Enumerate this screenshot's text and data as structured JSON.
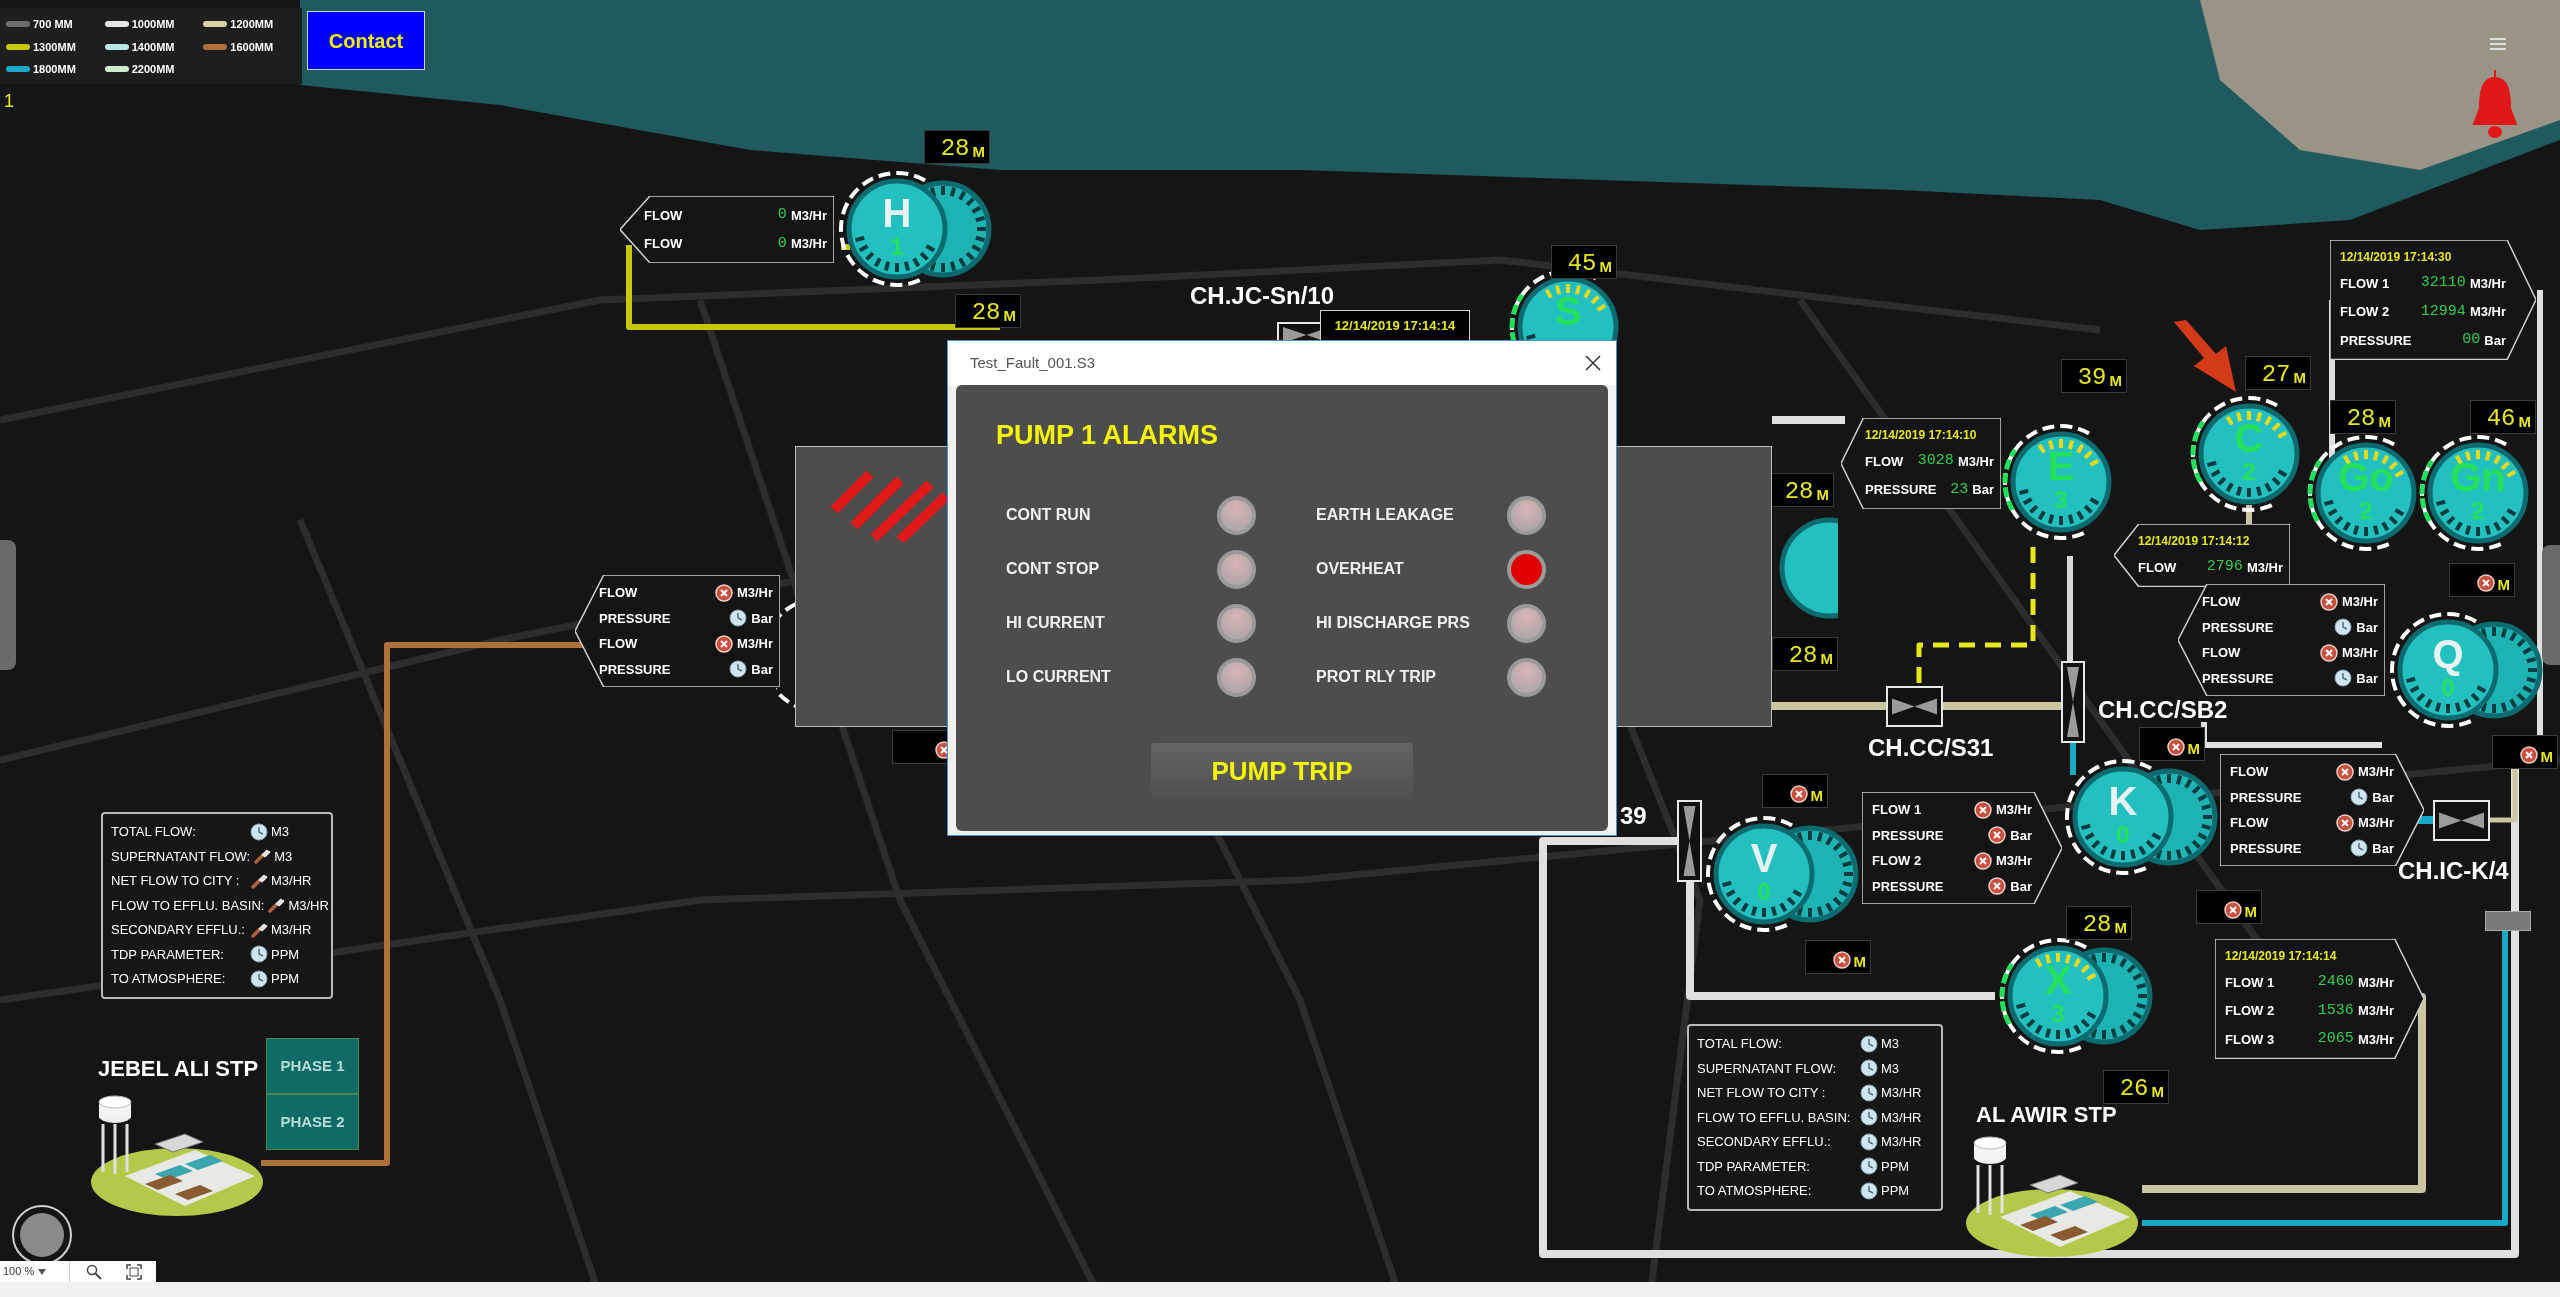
{
  "legend": [
    {
      "label": "700 MM",
      "color": "#6e6e6e"
    },
    {
      "label": "1000MM",
      "color": "#e6e6e6"
    },
    {
      "label": "1200MM",
      "color": "#d6d2a6"
    },
    {
      "label": "1300MM",
      "color": "#c8c800"
    },
    {
      "label": "1400MM",
      "color": "#b6e6e6"
    },
    {
      "label": "1600MM",
      "color": "#b0703c"
    },
    {
      "label": "1800MM",
      "color": "#18a8c8"
    },
    {
      "label": "2200MM",
      "color": "#cceccc"
    }
  ],
  "contact_button": "Contact",
  "page_indicator": "1",
  "pumps": [
    {
      "letter": "H",
      "number": "1",
      "running": false
    },
    {
      "letter": "S",
      "running": true
    },
    {
      "letter": "E",
      "number": "3",
      "running": true
    },
    {
      "letter": "C",
      "number": "2",
      "running": true
    },
    {
      "letter": "Go",
      "number": "2",
      "running": true
    },
    {
      "letter": "Gn",
      "number": "2",
      "running": true
    },
    {
      "letter": "Q",
      "number": "0",
      "running": false
    },
    {
      "letter": "K",
      "number": "0",
      "running": false
    },
    {
      "letter": "V",
      "number": "0",
      "running": false
    },
    {
      "letter": "X",
      "number": "3",
      "running": true
    }
  ],
  "displays": [
    {
      "kind": "value",
      "value": "28",
      "unit": "M"
    },
    {
      "kind": "value",
      "value": "28",
      "unit": "M"
    },
    {
      "kind": "value",
      "value": "45",
      "unit": "M"
    },
    {
      "kind": "value",
      "value": "28",
      "unit": "M"
    },
    {
      "kind": "value",
      "value": "28",
      "unit": "M"
    },
    {
      "kind": "value",
      "value": "39",
      "unit": "M"
    },
    {
      "kind": "value",
      "value": "27",
      "unit": "M"
    },
    {
      "kind": "value",
      "value": "28",
      "unit": "M"
    },
    {
      "kind": "value",
      "value": "46",
      "unit": "M"
    },
    {
      "kind": "error",
      "unit": "M"
    },
    {
      "kind": "error",
      "unit": "M"
    },
    {
      "kind": "error",
      "unit": "M"
    },
    {
      "kind": "error",
      "unit": "M"
    },
    {
      "kind": "error",
      "unit": "M"
    },
    {
      "kind": "error",
      "unit": "M"
    },
    {
      "kind": "value",
      "value": "28",
      "unit": "M"
    },
    {
      "kind": "value",
      "value": "26",
      "unit": "M"
    },
    {
      "kind": "error"
    }
  ],
  "flow_panels": [
    {
      "rows": [
        {
          "kind": "value",
          "label": "FLOW",
          "value": "0",
          "unit": "M3/Hr"
        },
        {
          "kind": "value",
          "label": "FLOW",
          "value": "0",
          "unit": "M3/Hr"
        }
      ]
    },
    {
      "rows": [
        {
          "kind": "error",
          "label": "FLOW",
          "unit": "M3/Hr"
        },
        {
          "kind": "clock",
          "label": "PRESSURE",
          "unit": "Bar"
        },
        {
          "kind": "error",
          "label": "FLOW",
          "unit": "M3/Hr"
        },
        {
          "kind": "clock",
          "label": "PRESSURE",
          "unit": "Bar"
        }
      ]
    },
    {
      "timestamp": "12/14/2019 17:14:10",
      "rows": [
        {
          "kind": "value",
          "label": "FLOW",
          "value": "3028",
          "unit": "M3/Hr"
        },
        {
          "kind": "value",
          "label": "PRESSURE",
          "value": "23",
          "unit": "Bar"
        }
      ]
    },
    {
      "timestamp": "12/14/2019 17:14:12",
      "rows": [
        {
          "kind": "value",
          "label": "FLOW",
          "value": "2796",
          "unit": "M3/Hr"
        }
      ]
    },
    {
      "timestamp": "12/14/2019 17:14:30",
      "rows": [
        {
          "kind": "value",
          "label": "FLOW 1",
          "value": "32110",
          "unit": "M3/Hr"
        },
        {
          "kind": "value",
          "label": "FLOW 2",
          "value": "12994",
          "unit": "M3/Hr"
        },
        {
          "kind": "value",
          "label": "PRESSURE",
          "value": "00",
          "unit": "Bar"
        }
      ]
    },
    {
      "rows": [
        {
          "kind": "error",
          "label": "FLOW",
          "unit": "M3/Hr"
        },
        {
          "kind": "clock",
          "label": "PRESSURE",
          "unit": "Bar"
        },
        {
          "kind": "error",
          "label": "FLOW",
          "unit": "M3/Hr"
        },
        {
          "kind": "clock",
          "label": "PRESSURE",
          "unit": "Bar"
        }
      ]
    },
    {
      "rows": [
        {
          "kind": "error",
          "label": "FLOW",
          "unit": "M3/Hr"
        },
        {
          "kind": "clock",
          "label": "PRESSURE",
          "unit": "Bar"
        },
        {
          "kind": "error",
          "label": "FLOW",
          "unit": "M3/Hr"
        },
        {
          "kind": "clock",
          "label": "PRESSURE",
          "unit": "Bar"
        }
      ]
    },
    {
      "rows": [
        {
          "kind": "error",
          "label": "FLOW 1",
          "unit": "M3/Hr"
        },
        {
          "kind": "error",
          "label": "PRESSURE",
          "unit": "Bar"
        },
        {
          "kind": "error",
          "label": "FLOW 2",
          "unit": "M3/Hr"
        },
        {
          "kind": "error",
          "label": "PRESSURE",
          "unit": "Bar"
        }
      ]
    },
    {
      "timestamp": "12/14/2019 17:14:14",
      "rows": [
        {
          "kind": "value",
          "label": "FLOW 1",
          "value": "2460",
          "unit": "M3/Hr"
        },
        {
          "kind": "value",
          "label": "FLOW 2",
          "value": "1536",
          "unit": "M3/Hr"
        },
        {
          "kind": "value",
          "label": "FLOW 3",
          "value": "2065",
          "unit": "M3/Hr"
        }
      ]
    }
  ],
  "timestamp_tag": "12/14/2019 17:14:14",
  "station_labels": [
    "CH.JC-Sn/10",
    "CH.CC/S31",
    "CH.CC/SB2",
    "CH.IC-K/4",
    "39"
  ],
  "summaries": [
    {
      "rows": [
        {
          "kind": "clock",
          "label": "TOTAL FLOW:",
          "unit": "M3"
        },
        {
          "kind": "wrench",
          "label": "SUPERNATANT FLOW:",
          "unit": "M3"
        },
        {
          "kind": "wrench",
          "label": "NET FLOW TO CITY :",
          "unit": "M3/HR"
        },
        {
          "kind": "wrench",
          "label": "FLOW TO EFFLU. BASIN:",
          "unit": "M3/HR"
        },
        {
          "kind": "wrench",
          "label": "SECONDARY EFFLU.:",
          "unit": "M3/HR"
        },
        {
          "kind": "clock",
          "label": "TDP PARAMETER:",
          "unit": "PPM"
        },
        {
          "kind": "clock",
          "label": "TO ATMOSPHERE:",
          "unit": "PPM"
        }
      ]
    },
    {
      "rows": [
        {
          "kind": "clock",
          "label": "TOTAL FLOW:",
          "unit": "M3"
        },
        {
          "kind": "clock",
          "label": "SUPERNATANT FLOW:",
          "unit": "M3"
        },
        {
          "kind": "clock",
          "label": "NET FLOW TO CITY :",
          "unit": "M3/HR"
        },
        {
          "kind": "clock",
          "label": "FLOW TO EFFLU. BASIN:",
          "unit": "M3/HR"
        },
        {
          "kind": "clock",
          "label": "SECONDARY EFFLU.:",
          "unit": "M3/HR"
        },
        {
          "kind": "clock",
          "label": "TDP PARAMETER:",
          "unit": "PPM"
        },
        {
          "kind": "clock",
          "label": "TO ATMOSPHERE:",
          "unit": "PPM"
        }
      ]
    }
  ],
  "plants": [
    {
      "name": "JEBEL ALI STP"
    },
    {
      "name": "AL AWIR STP"
    }
  ],
  "phase_buttons": [
    "PHASE 1",
    "PHASE 2"
  ],
  "dialog": {
    "title": "Test_Fault_001.S3",
    "heading": "PUMP 1 ALARMS",
    "alarms": [
      {
        "label": "CONT RUN",
        "on": false
      },
      {
        "label": "EARTH LEAKAGE",
        "on": false
      },
      {
        "label": "CONT STOP",
        "on": false
      },
      {
        "label": "OVERHEAT",
        "on": true
      },
      {
        "label": "HI CURRENT",
        "on": false
      },
      {
        "label": "HI DISCHARGE PRS",
        "on": false
      },
      {
        "label": "LO CURRENT",
        "on": false
      },
      {
        "label": "PROT RLY TRIP",
        "on": false
      }
    ],
    "button": "PUMP TRIP"
  },
  "view_toolbar": {
    "zoom": "100 %"
  }
}
